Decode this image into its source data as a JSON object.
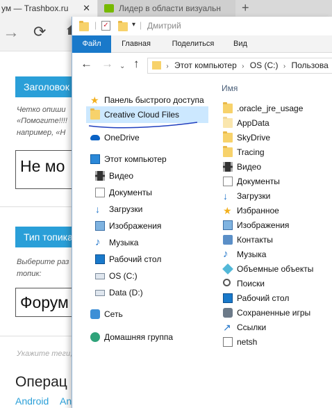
{
  "browser": {
    "tabs": [
      {
        "label": "ум — Trashbox.ru",
        "close": "✕"
      },
      {
        "label": "Лидер в области визуальн"
      }
    ],
    "new_tab": "+"
  },
  "webpage": {
    "section1_header": "Заголовок",
    "section1_hint_lines": [
      "Четко опиши",
      "«Помогите!!!!",
      "например, «Н"
    ],
    "title_input_value": "Не мо",
    "section2_header": "Тип топика",
    "section2_hint_lines": [
      "Выберите раз",
      "топик:"
    ],
    "forum_value": "Форум",
    "tags_hint": "Укажите теги,",
    "os_title": "Операц",
    "os_links": [
      "Android",
      "An"
    ]
  },
  "explorer": {
    "window_title": "Дмитрий",
    "ribbon_tabs": [
      "Файл",
      "Главная",
      "Поделиться",
      "Вид"
    ],
    "address_segments": [
      "Этот компьютер",
      "OS (C:)",
      "Пользова"
    ],
    "nav_items": [
      {
        "label": "Панель быстрого доступа",
        "icon": "star-icon"
      },
      {
        "label": "Creative Cloud Files",
        "icon": "folder-icon",
        "selected": true
      },
      {
        "label": "OneDrive",
        "icon": "cloud-icon"
      },
      {
        "label": "Этот компьютер",
        "icon": "computer-icon"
      },
      {
        "label": "Видео",
        "icon": "video-icon"
      },
      {
        "label": "Документы",
        "icon": "document-icon"
      },
      {
        "label": "Загрузки",
        "icon": "download-icon"
      },
      {
        "label": "Изображения",
        "icon": "pictures-icon"
      },
      {
        "label": "Музыка",
        "icon": "music-icon"
      },
      {
        "label": "Рабочий стол",
        "icon": "desktop-icon"
      },
      {
        "label": "OS (C:)",
        "icon": "drive-icon"
      },
      {
        "label": "Data (D:)",
        "icon": "drive-icon"
      },
      {
        "label": "Сеть",
        "icon": "network-icon"
      },
      {
        "label": "Домашняя группа",
        "icon": "homegroup-icon"
      }
    ],
    "column_header": "Имя",
    "files": [
      {
        "label": ".oracle_jre_usage",
        "icon": "folder-icon"
      },
      {
        "label": "AppData",
        "icon": "folder-faded-icon"
      },
      {
        "label": "SkyDrive",
        "icon": "folder-icon"
      },
      {
        "label": "Tracing",
        "icon": "folder-icon"
      },
      {
        "label": "Видео",
        "icon": "video-icon"
      },
      {
        "label": "Документы",
        "icon": "document-icon"
      },
      {
        "label": "Загрузки",
        "icon": "download-icon"
      },
      {
        "label": "Избранное",
        "icon": "favorites-icon"
      },
      {
        "label": "Изображения",
        "icon": "pictures-icon"
      },
      {
        "label": "Контакты",
        "icon": "contacts-icon"
      },
      {
        "label": "Музыка",
        "icon": "music-icon"
      },
      {
        "label": "Объемные объекты",
        "icon": "3d-objects-icon"
      },
      {
        "label": "Поиски",
        "icon": "search-icon"
      },
      {
        "label": "Рабочий стол",
        "icon": "desktop-icon"
      },
      {
        "label": "Сохраненные игры",
        "icon": "saved-games-icon"
      },
      {
        "label": "Ссылки",
        "icon": "links-icon"
      },
      {
        "label": "netsh",
        "icon": "file-icon"
      }
    ],
    "accent_color": "#1979ca",
    "selection_color": "#cce8ff"
  }
}
